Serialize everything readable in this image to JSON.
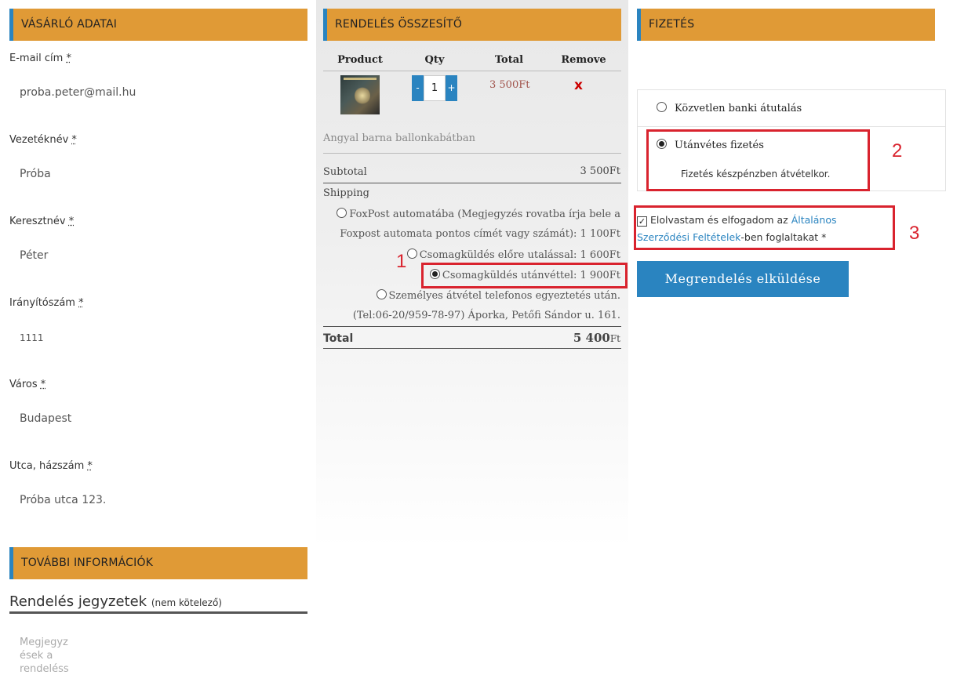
{
  "customer": {
    "header": "VÁSÁRLÓ ADATAI",
    "fields": [
      {
        "label": "E-mail cím",
        "req": "*",
        "value": "proba.peter@mail.hu"
      },
      {
        "label": "Vezetéknév",
        "req": "*",
        "value": "Próba"
      },
      {
        "label": "Keresztnév",
        "req": "*",
        "value": "Péter"
      },
      {
        "label": "Irányítószám",
        "req": "*",
        "value": "1111"
      },
      {
        "label": "Város",
        "req": "*",
        "value": "Budapest"
      },
      {
        "label": "Utca, házszám",
        "req": "*",
        "value": "Próba utca 123."
      }
    ]
  },
  "extra": {
    "header": "TOVÁBBI INFORMÁCIÓK",
    "notes_title": "Rendelés jegyzetek",
    "notes_optional": "(nem kötelező)",
    "notes_placeholder": "Megjegyz ések a rendeléss"
  },
  "summary": {
    "header": "RENDELÉS ÖSSZESÍTŐ",
    "columns": [
      "Product",
      "Qty",
      "Total",
      "Remove"
    ],
    "item": {
      "qty_minus": "-",
      "qty": "1",
      "qty_plus": "+",
      "total": "3 500Ft",
      "remove": "x",
      "name": "Angyal barna ballonkabátban"
    },
    "subtotal_label": "Subtotal",
    "subtotal_value": "3 500Ft",
    "shipping_label": "Shipping",
    "shipping_options": [
      {
        "line1": "FoxPost automatába (Megjegyzés rovatba írja bele a",
        "line2": "Foxpost automata pontos címét vagy számát): 1 100Ft",
        "checked": false
      },
      {
        "line1": "Csomagküldés előre utalással: 1 600Ft",
        "checked": false
      },
      {
        "line1": "Csomagküldés utánvéttel: 1 900Ft",
        "checked": true
      },
      {
        "line1": "Személyes átvétel telefonos egyeztetés után.",
        "line2": "(Tel:06-20/959-78-97) Áporka, Petőfi Sándor u. 161.",
        "checked": false
      }
    ],
    "total_label": "Total",
    "total_value": "5 400",
    "total_currency": "Ft"
  },
  "payment": {
    "header": "FIZETÉS",
    "options": [
      {
        "label": "Közvetlen banki átutalás",
        "checked": false
      },
      {
        "label": "Utánvétes fizetés",
        "checked": true,
        "description": "Fizetés készpénzben átvételkor."
      }
    ],
    "terms_prefix": "Elolvastam és elfogadom az ",
    "terms_link": "Általános Szerződési Feltételek",
    "terms_suffix": "-ben foglaltakat",
    "terms_req": "*",
    "submit": "Megrendelés elküldése"
  },
  "annotations": [
    "1",
    "2",
    "3"
  ],
  "colors": {
    "header_bg": "#e09a36",
    "accent_blue": "#2a84c0",
    "annotation_red": "#d9232e",
    "remove_red": "#cc0000",
    "price_color": "#a0524a"
  }
}
